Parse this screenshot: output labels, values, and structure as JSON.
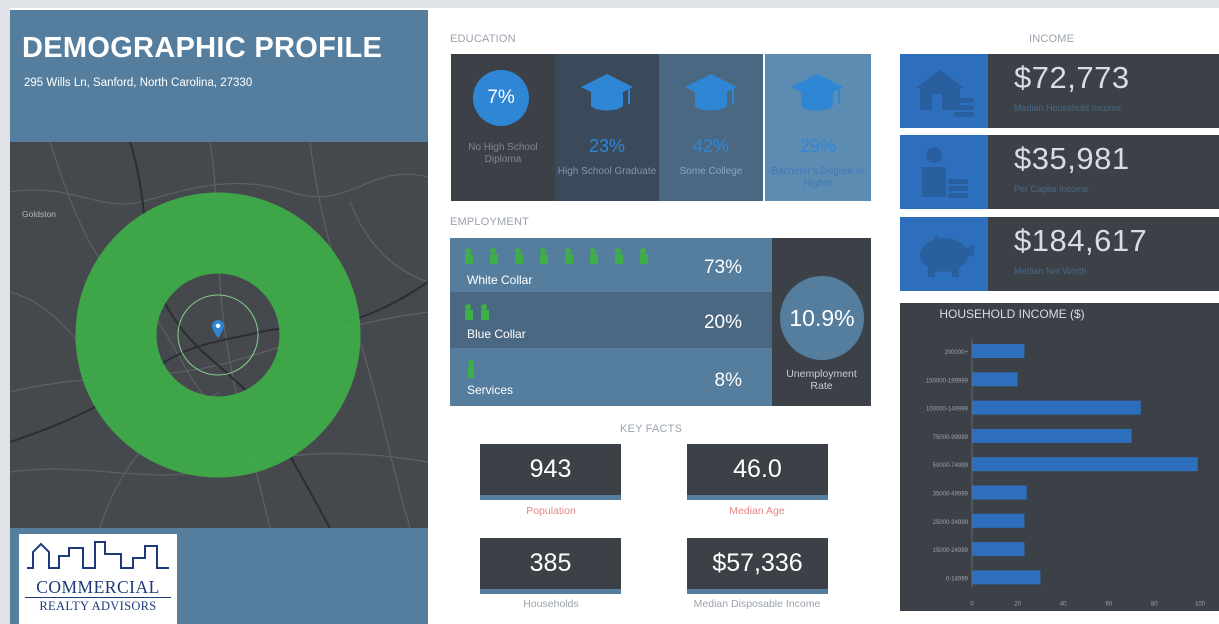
{
  "header": {
    "title": "DEMOGRAPHIC PROFILE",
    "address": "295 Wills Ln, Sanford, North Carolina, 27330"
  },
  "map": {
    "place_label": "Goldston"
  },
  "logo": {
    "line1": "COMMERCIAL",
    "line2": "REALTY ADVISORS"
  },
  "education": {
    "label": "EDUCATION",
    "items": [
      {
        "pct": "7%",
        "label": "No High School Diploma",
        "color": "#3c4147"
      },
      {
        "pct": "23%",
        "label": "High School Graduate",
        "color": "#3b4a5b"
      },
      {
        "pct": "42%",
        "label": "Some College",
        "color": "#4b6883"
      },
      {
        "pct": "29%",
        "label": "Bachelor's Degree or Higher",
        "color": "#5d8cb3"
      }
    ]
  },
  "employment": {
    "label": "EMPLOYMENT",
    "rows": [
      {
        "label": "White Collar",
        "pct": "73%",
        "icons": 8
      },
      {
        "label": "Blue Collar",
        "pct": "20%",
        "icons": 2
      },
      {
        "label": "Services",
        "pct": "8%",
        "icons": 1
      }
    ],
    "unemployment_rate": "10.9%",
    "unemployment_label_1": "Unemployment",
    "unemployment_label_2": "Rate"
  },
  "key_facts": {
    "label": "KEY FACTS",
    "items": [
      {
        "value": "943",
        "label": "Population"
      },
      {
        "value": "46.0",
        "label": "Median Age"
      },
      {
        "value": "385",
        "label": "Households"
      },
      {
        "value": "$57,336",
        "label": "Median Disposable Income"
      }
    ]
  },
  "income": {
    "label": "INCOME",
    "items": [
      {
        "value": "$72,773",
        "label": "Median Household Income",
        "icon": "house-money-icon"
      },
      {
        "value": "$35,981",
        "label": "Per Capita Income",
        "icon": "person-coins-icon"
      },
      {
        "value": "$184,617",
        "label": "Median Net Worth",
        "icon": "piggy-bank-icon"
      }
    ]
  },
  "chart_data": {
    "type": "bar",
    "orientation": "horizontal",
    "title": "HOUSEHOLD INCOME ($)",
    "categories": [
      "200000+",
      "150000-199999",
      "100000-149999",
      "75000-99999",
      "50000-74999",
      "35000-49999",
      "25000-34999",
      "15000-24999",
      "0-14999"
    ],
    "values": [
      23,
      20,
      74,
      70,
      99,
      24,
      23,
      23,
      30
    ],
    "xticks": [
      "0",
      "20",
      "40",
      "60",
      "80",
      "100"
    ],
    "xlim": [
      0,
      100
    ],
    "bar_color": "#2e6fbd",
    "grid": false
  },
  "colors": {
    "header_blue": "#557e9e",
    "dark_panel": "#3c4147",
    "accent_blue": "#2e86d4",
    "ring_green": "#3fae49",
    "employment_green": "#3fae49",
    "fact_label_red": "#e48585"
  }
}
